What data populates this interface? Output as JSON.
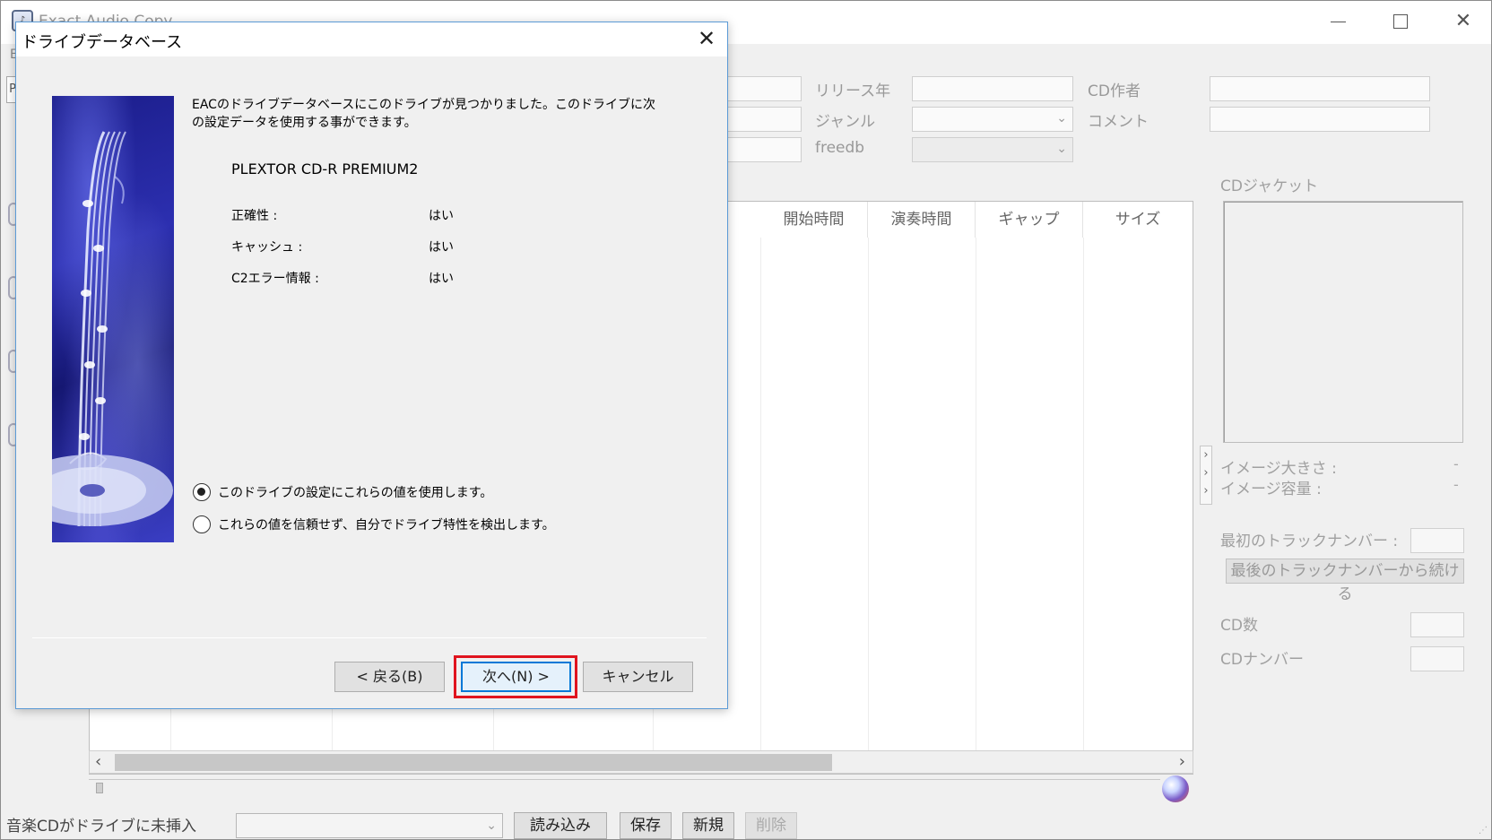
{
  "main_window": {
    "title": "Exact Audio Copy",
    "menubar_stub": "E",
    "left_strip_letter": "P",
    "metadata": {
      "release_year_label": "リリース年",
      "genre_label": "ジャンル",
      "freedb_label": "freedb",
      "cd_author_label": "CD作者",
      "comment_label": "コメント"
    },
    "tracklist": {
      "columns": [
        "開始時間",
        "演奏時間",
        "ギャップ",
        "サイズ"
      ]
    },
    "right_panel": {
      "cd_jacket_label": "CDジャケット",
      "image_size_label": "イメージ大きさ :",
      "image_size_value": "-",
      "image_volume_label": "イメージ容量 :",
      "image_volume_value": "-",
      "first_track_number_label": "最初のトラックナンバー :",
      "continue_button": "最後のトラックナンバーから続ける",
      "cd_count_label": "CD数",
      "cd_number_label": "CDナンバー"
    },
    "statusbar": {
      "status": "音楽CDがドライブに未挿入",
      "buttons": [
        "読み込み",
        "保存",
        "新規",
        "削除"
      ]
    }
  },
  "dialog": {
    "title": "ドライブデータベース",
    "description": "EACのドライブデータベースにこのドライブが見つかりました。このドライブに次の設定データを使用する事ができます。",
    "drive_name": "PLEXTOR CD-R   PREMIUM2",
    "properties": [
      {
        "label": "正確性 :",
        "value": "はい"
      },
      {
        "label": "キャッシュ :",
        "value": "はい"
      },
      {
        "label": "C2エラー情報 :",
        "value": "はい"
      }
    ],
    "options": [
      {
        "label": "このドライブの設定にこれらの値を使用します。",
        "checked": true
      },
      {
        "label": "これらの値を信頼せず、自分でドライブ特性を検出します。",
        "checked": false
      }
    ],
    "buttons": {
      "back": "< 戻る(B)",
      "next": "次へ(N) >",
      "cancel": "キャンセル"
    },
    "highlight_color": "#e0141e"
  }
}
